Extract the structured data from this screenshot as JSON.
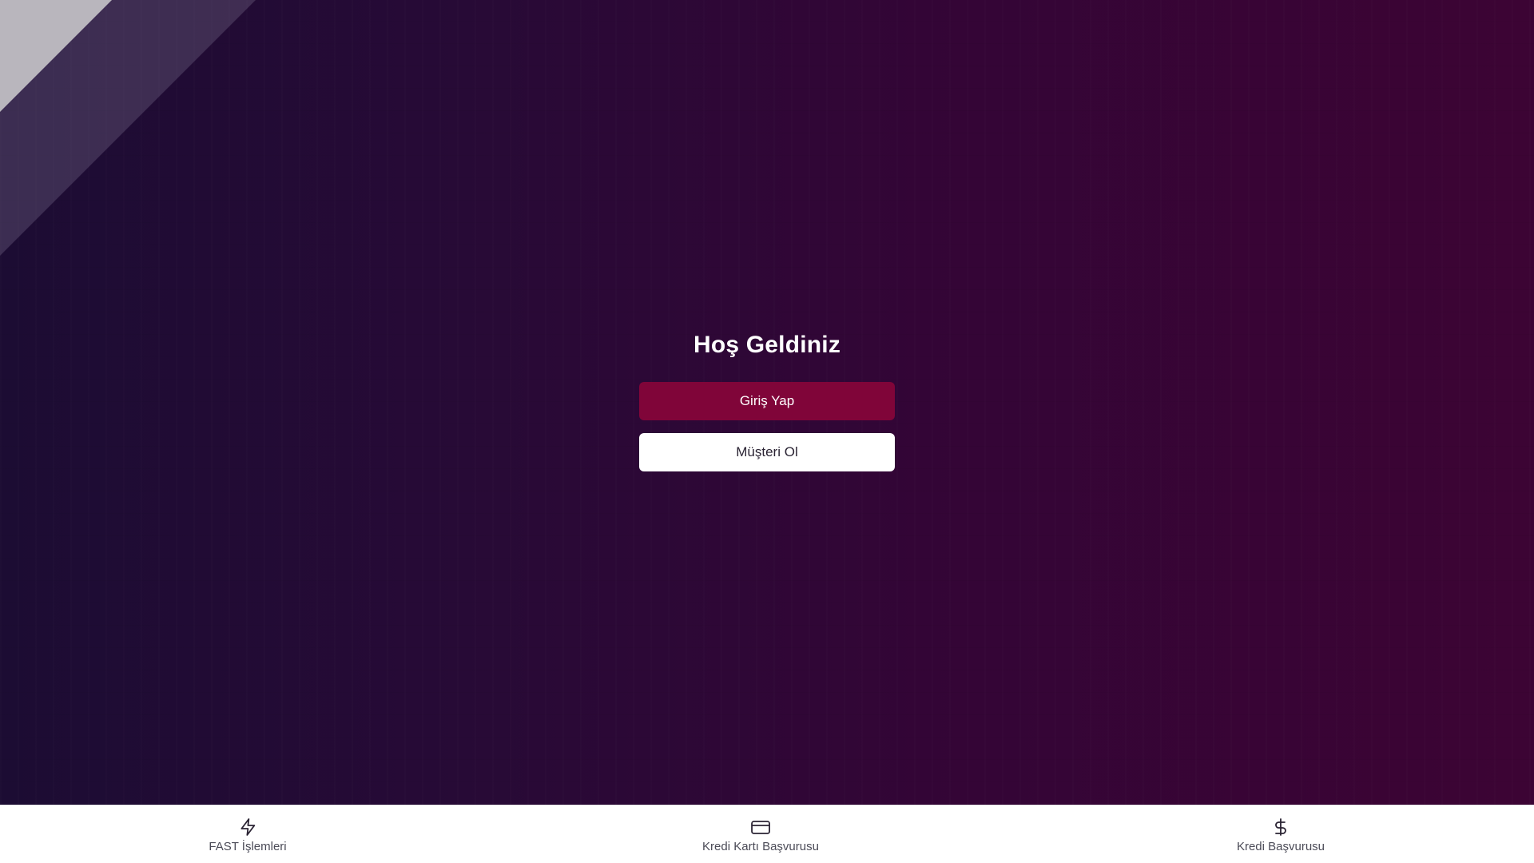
{
  "colors": {
    "background_start": "#1c0c33",
    "background_end": "#3c0434",
    "primary_button": "#800539",
    "secondary_button": "#ffffff",
    "nav_background": "#ffffff",
    "nav_text": "#4b4b57"
  },
  "hero": {
    "title": "Hoş Geldiniz"
  },
  "actions": {
    "login_label": "Giriş Yap",
    "register_label": "Müşteri Ol"
  },
  "bottom_nav": {
    "items": [
      {
        "label": "FAST İşlemleri",
        "icon": "lightning-icon"
      },
      {
        "label": "Kredi Kartı Başvurusu",
        "icon": "credit-card-icon"
      },
      {
        "label": "Kredi Başvurusu",
        "icon": "dollar-icon"
      }
    ]
  }
}
